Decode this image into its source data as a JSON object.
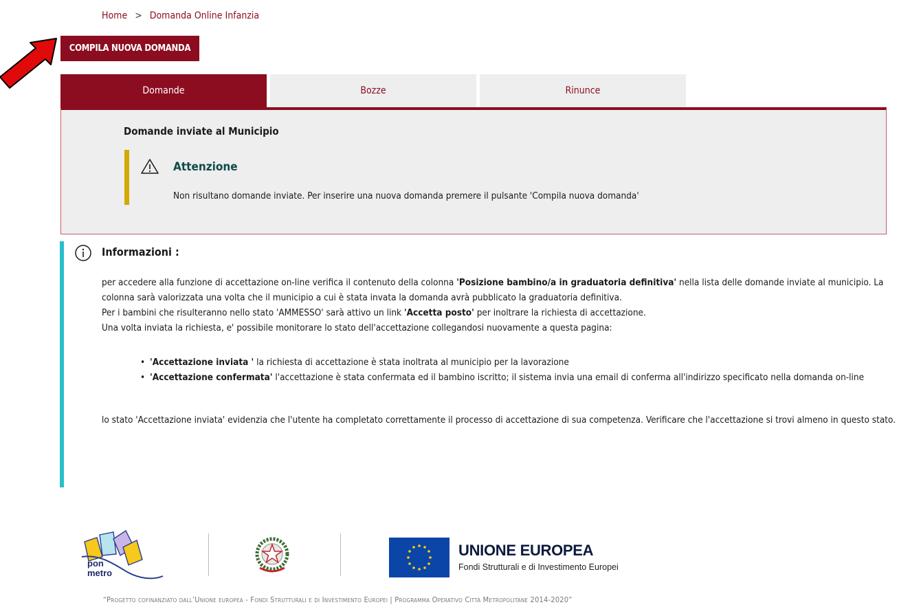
{
  "breadcrumb": {
    "home": "Home",
    "separator": ">",
    "current": "Domanda Online Infanzia"
  },
  "compila_button": "COMPILA NUOVA DOMANDA",
  "tabs": [
    {
      "label": "Domande",
      "active": true
    },
    {
      "label": "Bozze",
      "active": false
    },
    {
      "label": "Rinunce",
      "active": false
    }
  ],
  "panel": {
    "title": "Domande inviate al Municipio",
    "warning": {
      "title": "Attenzione",
      "text": "Non risultano domande inviate. Per inserire una nuova domanda premere il pulsante 'Compila nuova domanda'"
    }
  },
  "info": {
    "title": "Informazioni :",
    "p1_a": "per accedere alla funzione di accettazione on-line verifica il contenuto della colonna ",
    "p1_b": "'Posizione bambino/a in graduatoria definitiva'",
    "p1_c": " nella lista delle domande inviate al municipio. La colonna sarà valorizzata una volta che il municipio a cui è stata invata la domanda avrà pubblicato la graduatoria definitiva.",
    "p2_a": "Per i bambini che risulteranno nello stato 'AMMESSO' sarà attivo un link ",
    "p2_b": "'Accetta posto'",
    "p2_c": " per inoltrare la richiesta di accettazione.",
    "p3": "Una volta inviata la richiesta, e' possibile monitorare lo stato dell'accettazione collegandosi nuovamente a questa pagina:",
    "bullet1_b": "'Accettazione inviata '",
    "bullet1_t": " la richiesta di accettazione è stata inoltrata al municipio per la lavorazione",
    "bullet2_b": "'Accettazione confermata'",
    "bullet2_t": " l'accettazione è stata confermata ed il bambino iscritto; il sistema invia una email di conferma all'indirizzo specificato nella domanda on-line",
    "closing": "lo stato 'Accettazione inviata' evidenzia che l'utente ha completato correttamente il processo di accettazione di sua competenza. Verificare che l'accettazione si trovi almeno in questo stato."
  },
  "footer": {
    "pon_text_1": "pon",
    "pon_text_2": "metro",
    "eu_title": "UNIONE EUROPEA",
    "eu_subtitle": "Fondi Strutturali e di Investimento Europei",
    "caption": "“Progetto cofinanziato dall’Unione europea - Fondi Strutturali e di Investimento Europei | Programma Operativo Città Metropolitane 2014-2020”"
  },
  "colors": {
    "brand": "#8b0d1f",
    "warning": "#d3a800",
    "info": "#2abfcd"
  }
}
